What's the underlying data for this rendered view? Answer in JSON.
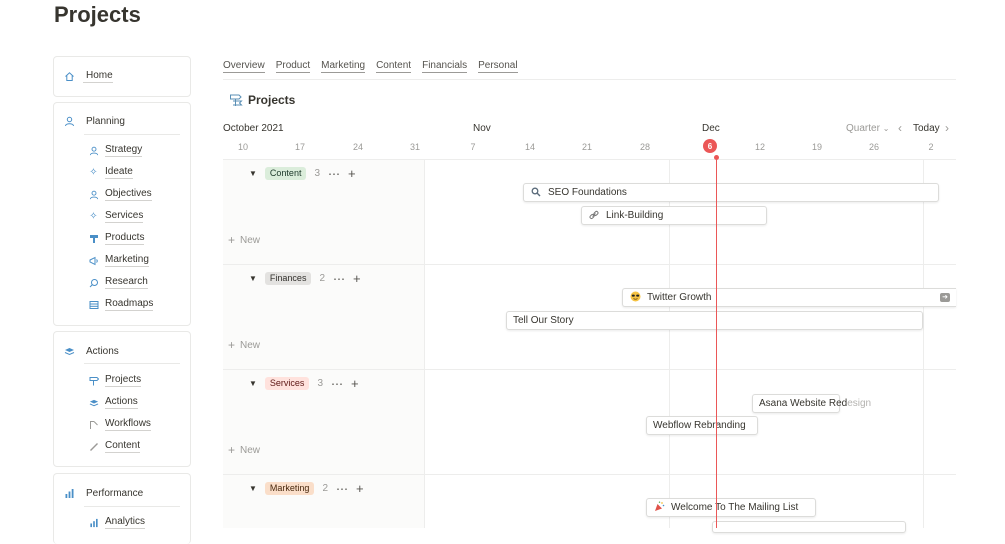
{
  "page": {
    "title": "Projects"
  },
  "sidebar": {
    "home": {
      "label": "Home",
      "icon": "home-icon"
    },
    "planning": {
      "label": "Planning",
      "items": [
        {
          "label": "Strategy",
          "icon": "person-icon"
        },
        {
          "label": "Ideate",
          "icon": "sparkle-icon"
        },
        {
          "label": "Objectives",
          "icon": "person-icon"
        },
        {
          "label": "Services",
          "icon": "sparkle-icon"
        },
        {
          "label": "Products",
          "icon": "box-icon"
        },
        {
          "label": "Marketing",
          "icon": "megaphone-icon"
        },
        {
          "label": "Research",
          "icon": "magnifier-icon"
        },
        {
          "label": "Roadmaps",
          "icon": "table-icon"
        }
      ]
    },
    "actions": {
      "label": "Actions",
      "items": [
        {
          "label": "Projects",
          "icon": "signpost-icon"
        },
        {
          "label": "Actions",
          "icon": "stack-icon"
        },
        {
          "label": "Workflows",
          "icon": "flow-icon"
        },
        {
          "label": "Content",
          "icon": "pen-icon"
        }
      ]
    },
    "performance": {
      "label": "Performance",
      "items": [
        {
          "label": "Analytics",
          "icon": "bar-chart-icon"
        }
      ]
    }
  },
  "tabs": [
    "Overview",
    "Product",
    "Marketing",
    "Content",
    "Financials",
    "Personal"
  ],
  "database": {
    "title": "Projects",
    "icon": "signpost-icon"
  },
  "timeline": {
    "months": {
      "oct": "October 2021",
      "nov": "Nov",
      "dec": "Dec"
    },
    "days": [
      "10",
      "17",
      "24",
      "31",
      "7",
      "14",
      "21",
      "28",
      "12",
      "19",
      "26",
      "2"
    ],
    "today_day": "6",
    "view": "Quarter",
    "today_label": "Today",
    "new_label": "New"
  },
  "groups": [
    {
      "name": "Content",
      "count": "3",
      "tag_bg": "#dbeddb",
      "tag_fg": "#1c3829"
    },
    {
      "name": "Finances",
      "count": "2",
      "tag_bg": "#e3e2e0",
      "tag_fg": "#32302c"
    },
    {
      "name": "Services",
      "count": "3",
      "tag_bg": "#ffe2dd",
      "tag_fg": "#5d1715"
    },
    {
      "name": "Marketing",
      "count": "2",
      "tag_bg": "#fadec9",
      "tag_fg": "#49290e"
    }
  ],
  "bars": {
    "seo": {
      "label": "SEO Foundations",
      "icon": "magnifier-icon"
    },
    "link": {
      "label": "Link-Building",
      "icon": "link-icon"
    },
    "twitter": {
      "label": "Twitter Growth",
      "icon": "sunglasses-emoji-icon"
    },
    "story": {
      "label": "Tell Our Story"
    },
    "asana_a": "Asana Website Red",
    "asana_b": "esign",
    "webflow": {
      "label": "Webflow Rebranding"
    },
    "mailing": {
      "label": "Welcome To The Mailing List",
      "icon": "party-popper-icon"
    }
  },
  "colors": {
    "accent_today": "#eb5757",
    "icon_blue": "#4a8fc7"
  }
}
